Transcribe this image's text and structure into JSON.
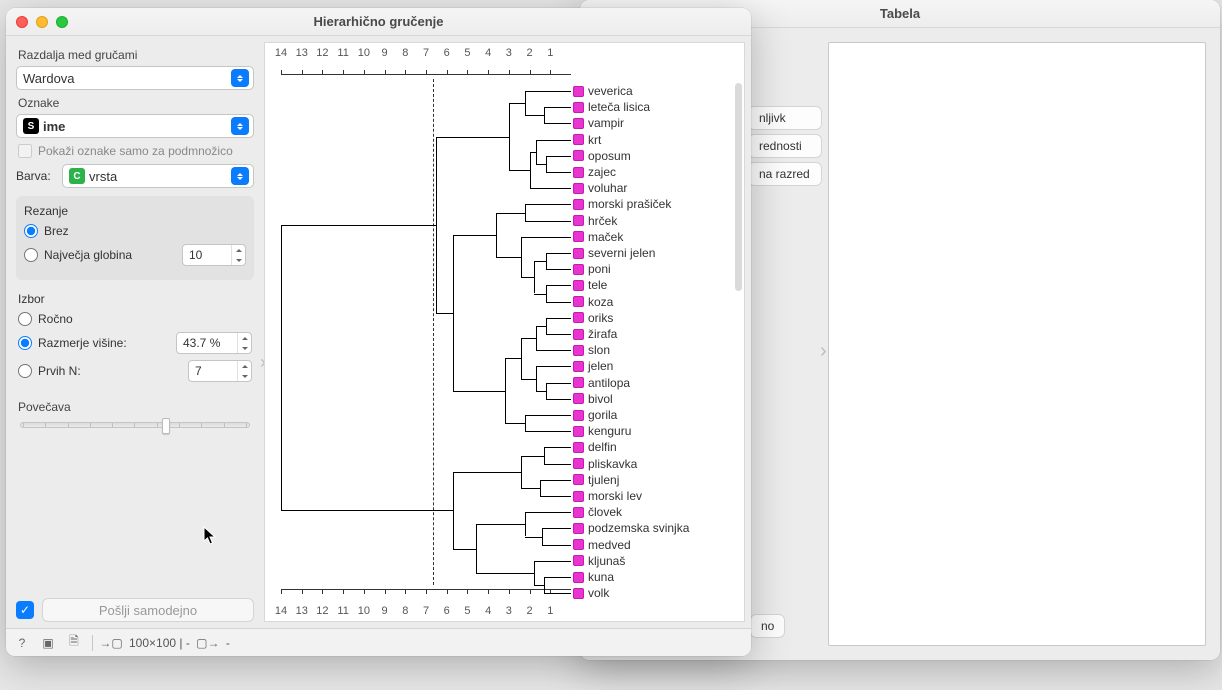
{
  "tabela": {
    "title": "Tabela",
    "peek_items": [
      "nljivk",
      "rednosti",
      "na razred"
    ],
    "send_auto": "no"
  },
  "hg": {
    "title": "Hierarhično gručenje",
    "linkage_label": "Razdalja med gručami",
    "linkage_value": "Wardova",
    "labels_section": "Oznake",
    "labels_value": "ime",
    "show_subset_label": "Pokaži oznake samo za podmnožico",
    "color_label": "Barva:",
    "color_value": "vrsta",
    "cut_section": "Rezanje",
    "cut_none": "Brez",
    "cut_maxdepth": "Največja globina",
    "cut_maxdepth_val": "10",
    "sel_section": "Izbor",
    "sel_manual": "Ročno",
    "sel_ratio": "Razmerje višine:",
    "sel_ratio_val": "43.7 %",
    "sel_topn": "Prvih N:",
    "sel_topn_val": "7",
    "zoom_label": "Povečava",
    "send_auto_label": "Pošlji samodejno",
    "status_dims": "100×100 | -",
    "status_out": "-"
  },
  "chart_data": {
    "type": "dendrogram",
    "xlabel": "",
    "xticks": [
      14,
      13,
      12,
      11,
      10,
      9,
      8,
      7,
      6,
      5,
      4,
      3,
      2,
      1
    ],
    "xlim": [
      14,
      0
    ],
    "cut_line_x": 6.3,
    "color": "#e934d2",
    "leaves": [
      "veverica",
      "leteča lisica",
      "vampir",
      "krt",
      "oposum",
      "zajec",
      "voluhar",
      "morski prašiček",
      "hrček",
      "maček",
      "severni jelen",
      "poni",
      "tele",
      "koza",
      "oriks",
      "žirafa",
      "slon",
      "jelen",
      "antilopa",
      "bivol",
      "gorila",
      "kenguru",
      "delfin",
      "pliskavka",
      "tjulenj",
      "morski lev",
      "človek",
      "podzemska svinjka",
      "medved",
      "kljunaš",
      "kuna",
      "volk"
    ],
    "merges": [
      {
        "left": "leteča lisica",
        "right": "vampir",
        "h": 1.3,
        "id": "m0"
      },
      {
        "left": "veverica",
        "right": "m0",
        "h": 2.2,
        "id": "m1"
      },
      {
        "left": "oposum",
        "right": "zajec",
        "h": 1.2,
        "id": "m2"
      },
      {
        "left": "krt",
        "right": "m2",
        "h": 1.7,
        "id": "m3"
      },
      {
        "left": "m3",
        "right": "voluhar",
        "h": 2.0,
        "id": "m4"
      },
      {
        "left": "m1",
        "right": "m4",
        "h": 3.0,
        "id": "m5"
      },
      {
        "left": "morski prašiček",
        "right": "hrček",
        "h": 2.2,
        "id": "m6"
      },
      {
        "left": "severni jelen",
        "right": "poni",
        "h": 1.2,
        "id": "m7"
      },
      {
        "left": "tele",
        "right": "koza",
        "h": 1.2,
        "id": "m8"
      },
      {
        "left": "m7",
        "right": "m8",
        "h": 1.8,
        "id": "m9"
      },
      {
        "left": "maček",
        "right": "m9",
        "h": 2.4,
        "id": "m10"
      },
      {
        "left": "m6",
        "right": "m10",
        "h": 3.6,
        "id": "m11"
      },
      {
        "left": "oriks",
        "right": "žirafa",
        "h": 1.2,
        "id": "m12"
      },
      {
        "left": "m12",
        "right": "slon",
        "h": 1.7,
        "id": "m13"
      },
      {
        "left": "antilopa",
        "right": "bivol",
        "h": 1.2,
        "id": "m14"
      },
      {
        "left": "jelen",
        "right": "m14",
        "h": 1.7,
        "id": "m15"
      },
      {
        "left": "m13",
        "right": "m15",
        "h": 2.4,
        "id": "m16"
      },
      {
        "left": "gorila",
        "right": "kenguru",
        "h": 2.2,
        "id": "m17"
      },
      {
        "left": "m16",
        "right": "m17",
        "h": 3.2,
        "id": "m18"
      },
      {
        "left": "m11",
        "right": "m18",
        "h": 5.7,
        "id": "m19"
      },
      {
        "left": "m5",
        "right": "m19",
        "h": 6.5,
        "id": "m20"
      },
      {
        "left": "delfin",
        "right": "pliskavka",
        "h": 1.3,
        "id": "m21"
      },
      {
        "left": "tjulenj",
        "right": "morski lev",
        "h": 1.5,
        "id": "m22"
      },
      {
        "left": "m21",
        "right": "m22",
        "h": 2.4,
        "id": "m23"
      },
      {
        "left": "podzemska svinjka",
        "right": "medved",
        "h": 1.4,
        "id": "m24"
      },
      {
        "left": "človek",
        "right": "m24",
        "h": 2.2,
        "id": "m25"
      },
      {
        "left": "kuna",
        "right": "volk",
        "h": 1.3,
        "id": "m26"
      },
      {
        "left": "kljunaš",
        "right": "m26",
        "h": 1.8,
        "id": "m27"
      },
      {
        "left": "m25",
        "right": "m27",
        "h": 4.6,
        "id": "m28"
      },
      {
        "left": "m23",
        "right": "m28",
        "h": 5.7,
        "id": "m29"
      },
      {
        "left": "m20",
        "right": "m29",
        "h": 14.0,
        "id": "m30"
      }
    ]
  }
}
